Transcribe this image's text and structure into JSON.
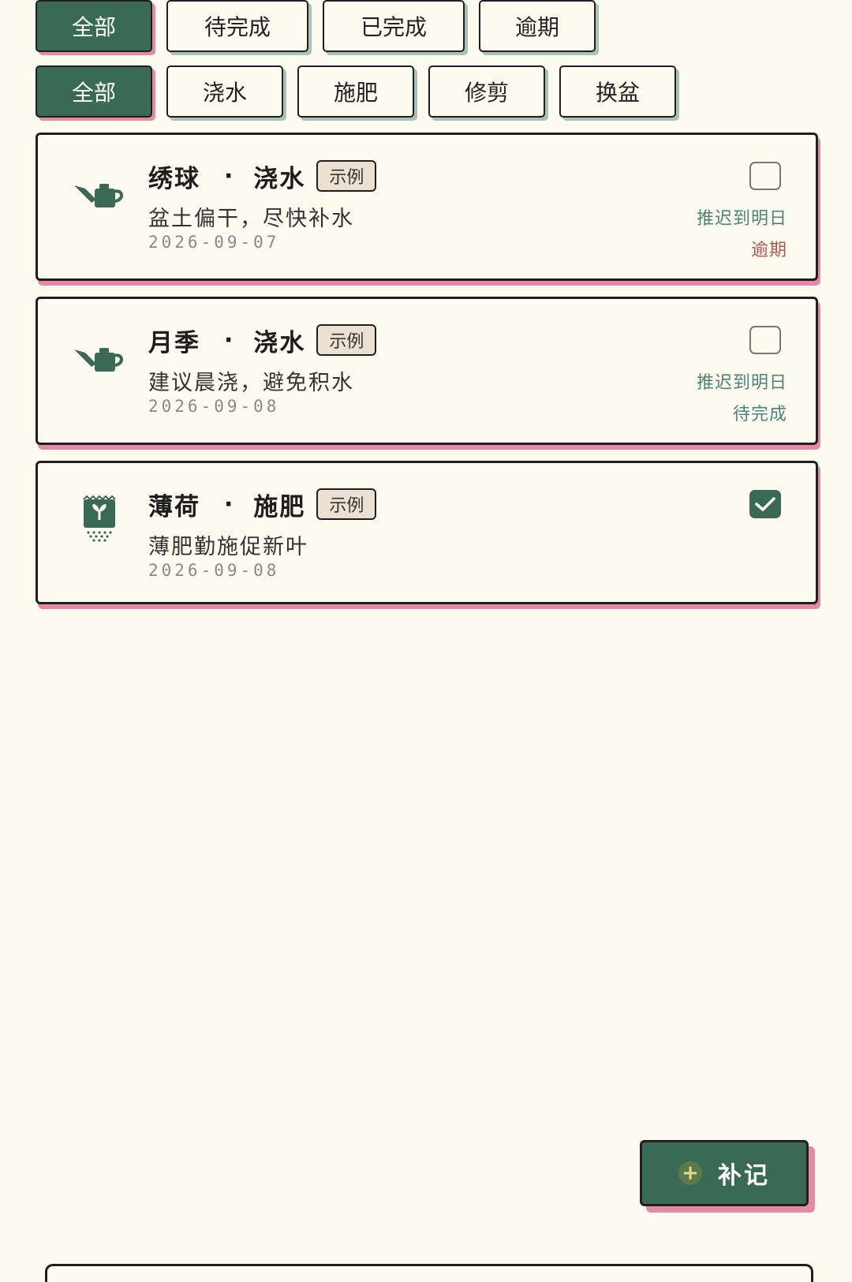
{
  "filters": {
    "status": [
      {
        "label": "全部",
        "active": true
      },
      {
        "label": "待完成",
        "active": false
      },
      {
        "label": "已完成",
        "active": false
      },
      {
        "label": "逾期",
        "active": false
      }
    ],
    "type": [
      {
        "label": "全部",
        "active": true
      },
      {
        "label": "浇水",
        "active": false
      },
      {
        "label": "施肥",
        "active": false
      },
      {
        "label": "修剪",
        "active": false
      },
      {
        "label": "换盆",
        "active": false
      }
    ]
  },
  "tasks": [
    {
      "icon": "watering-can-icon",
      "plant": "绣球",
      "separator": "·",
      "task": "浇水",
      "badge": "示例",
      "note": "盆土偏干，尽快补水",
      "date": "2026-09-07",
      "checked": false,
      "postpone": "推迟到明日",
      "status": "逾期",
      "status_color": "#b4544e"
    },
    {
      "icon": "watering-can-icon",
      "plant": "月季",
      "separator": "·",
      "task": "浇水",
      "badge": "示例",
      "note": "建议晨浇，避免积水",
      "date": "2026-09-08",
      "checked": false,
      "postpone": "推迟到明日",
      "status": "待完成",
      "status_color": "#4c8478"
    },
    {
      "icon": "fertilizer-bag-icon",
      "plant": "薄荷",
      "separator": "·",
      "task": "施肥",
      "badge": "示例",
      "note": "薄肥勤施促新叶",
      "date": "2026-09-08",
      "checked": true
    }
  ],
  "fab": {
    "icon": "plus-icon",
    "label": "补记"
  },
  "colors": {
    "accent": "#3a6a55",
    "shadow_pink": "#e58aa6",
    "background": "#fdfaf0",
    "link": "#4c8478",
    "overdue": "#b4544e"
  }
}
